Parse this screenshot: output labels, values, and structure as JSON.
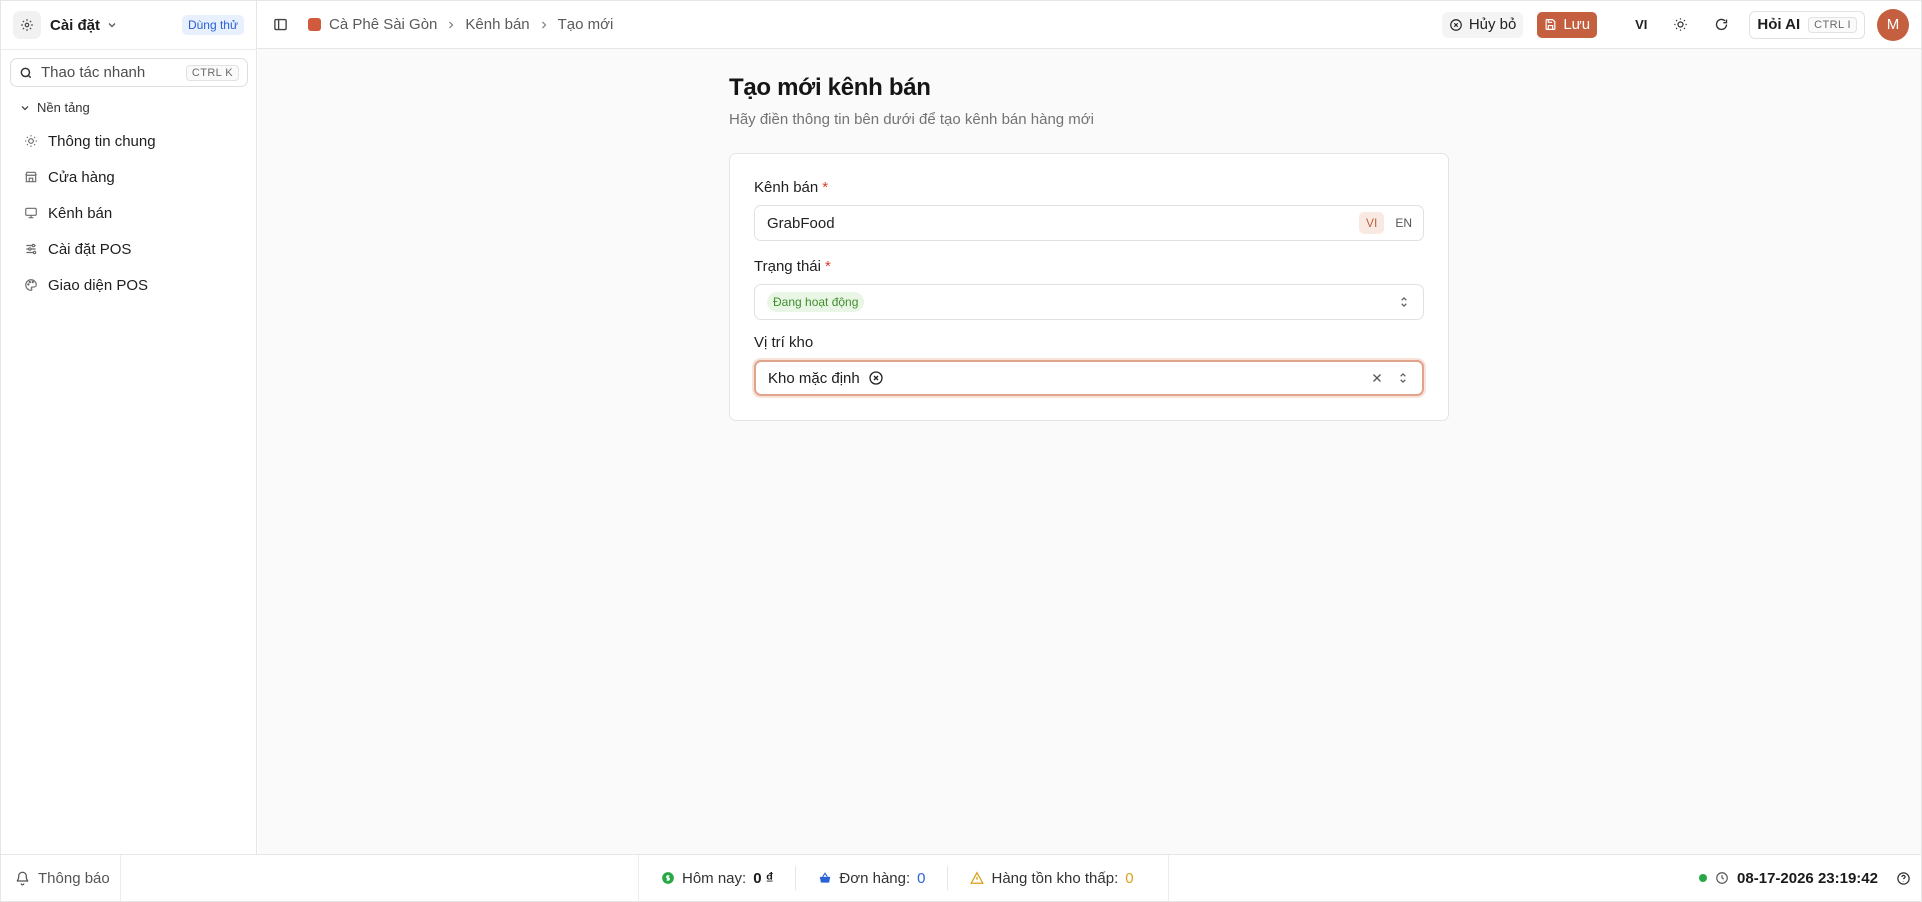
{
  "sidebar": {
    "title": "Cài đặt",
    "badge": "Dùng thử",
    "search": {
      "placeholder": "Thao tác nhanh",
      "shortcut": "CTRL K"
    },
    "section": "Nền tảng",
    "items": [
      {
        "label": "Thông tin chung",
        "icon": "sun-icon"
      },
      {
        "label": "Cửa hàng",
        "icon": "store-icon"
      },
      {
        "label": "Kênh bán",
        "icon": "monitor-icon"
      },
      {
        "label": "Cài đặt POS",
        "icon": "sliders-icon"
      },
      {
        "label": "Giao diện POS",
        "icon": "palette-icon"
      }
    ]
  },
  "header": {
    "breadcrumbs": [
      "Cà Phê Sài Gòn",
      "Kênh bán",
      "Tạo mới"
    ],
    "cancel_label": "Hủy bỏ",
    "save_label": "Lưu",
    "lang": "VI",
    "ask_ai_label": "Hỏi AI",
    "ask_ai_shortcut": "CTRL I",
    "avatar_initial": "M",
    "accent_color": "#c4603f"
  },
  "page": {
    "title": "Tạo mới kênh bán",
    "subtitle": "Hãy điền thông tin bên dưới để tạo kênh bán hàng mới"
  },
  "form": {
    "channel": {
      "label": "Kênh bán",
      "required": "*",
      "value": "GrabFood",
      "lang_options": [
        "VI",
        "EN"
      ],
      "active_lang": "VI"
    },
    "status": {
      "label": "Trạng thái",
      "required": "*",
      "value": "Đang hoạt động",
      "color": "#3f8f2d"
    },
    "warehouse": {
      "label": "Vị trí kho",
      "selected": "Kho mặc định"
    }
  },
  "footer": {
    "notifications": "Thông báo",
    "today_label": "Hôm nay:",
    "today_value": "0 ₫",
    "orders_label": "Đơn hàng:",
    "orders_value": "0",
    "low_stock_label": "Hàng tồn kho thấp:",
    "low_stock_value": "0",
    "datetime": "08-17-2026 23:19:42"
  }
}
